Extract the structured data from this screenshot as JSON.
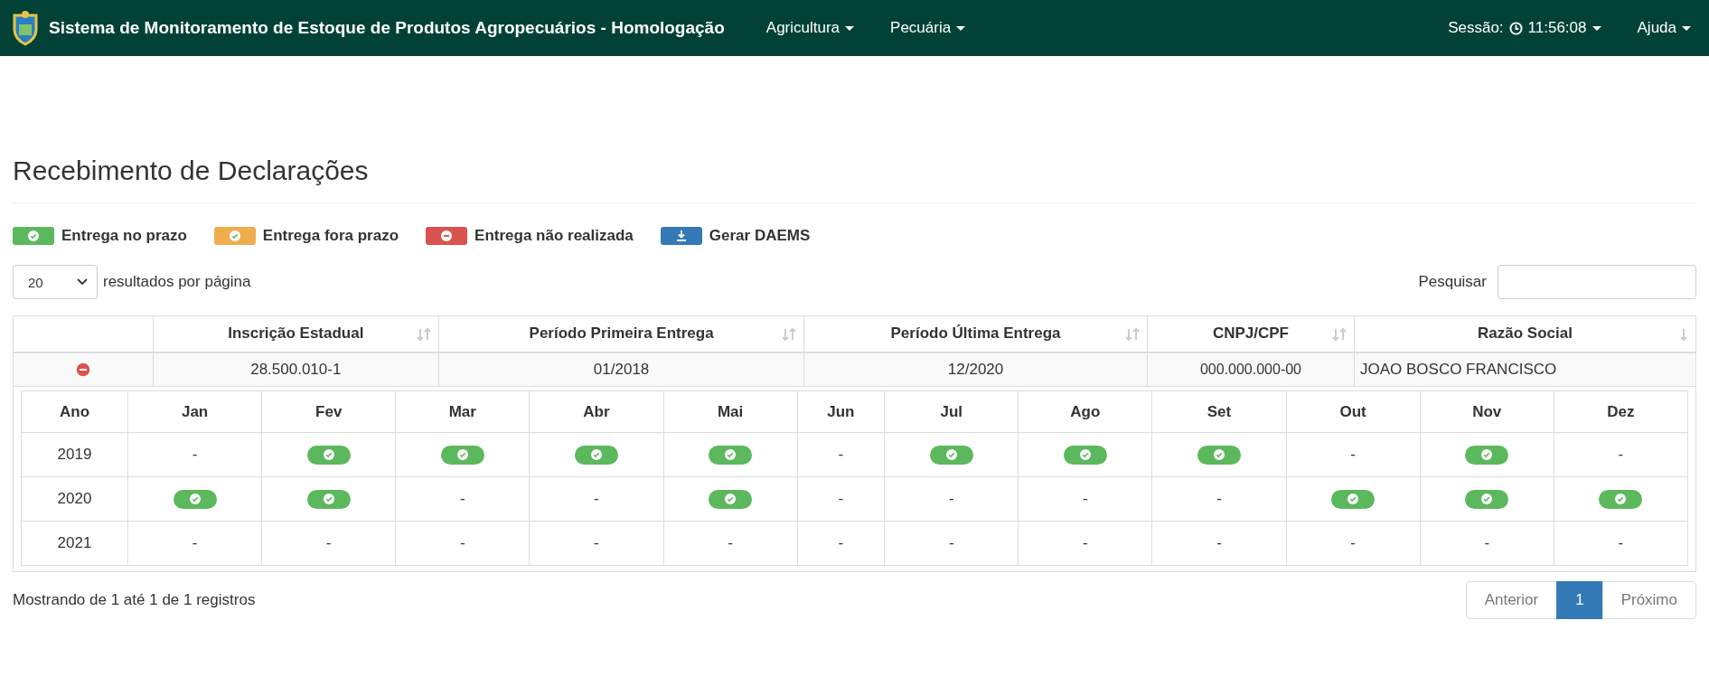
{
  "navbar": {
    "brand": "Sistema de Monitoramento de Estoque de Produtos Agropecuários - Homologação",
    "menus": [
      {
        "label": "Agricultura"
      },
      {
        "label": "Pecuária"
      }
    ],
    "session": {
      "label": "Sessão:",
      "time": "11:56:08"
    },
    "help": {
      "label": "Ajuda"
    }
  },
  "page_title": "Recebimento de Declarações",
  "legend": [
    {
      "kind": "on_time",
      "label": "Entrega no prazo"
    },
    {
      "kind": "late",
      "label": "Entrega fora prazo"
    },
    {
      "kind": "missing",
      "label": "Entrega não realizada"
    },
    {
      "kind": "download",
      "label": "Gerar DAEMS"
    }
  ],
  "page_size": {
    "value": "20",
    "label": "resultados por página"
  },
  "search": {
    "label": "Pesquisar"
  },
  "table": {
    "columns": [
      {
        "label": "Inscrição Estadual",
        "sorted": false
      },
      {
        "label": "Período Primeira Entrega",
        "sorted": false
      },
      {
        "label": "Período Última Entrega",
        "sorted": false
      },
      {
        "label": "CNPJ/CPF",
        "sorted": false
      },
      {
        "label": "Razão Social",
        "sorted": true
      }
    ],
    "rows": [
      {
        "expanded": true,
        "cells": [
          "28.500.010-1",
          "01/2018",
          "12/2020",
          "000.000.000-00",
          "JOAO BOSCO FRANCISCO"
        ],
        "detail": {
          "columns": [
            "Ano",
            "Jan",
            "Fev",
            "Mar",
            "Abr",
            "Mai",
            "Jun",
            "Jul",
            "Ago",
            "Set",
            "Out",
            "Nov",
            "Dez"
          ],
          "rows": [
            {
              "year": "2019",
              "months": [
                {
                  "kind": "text",
                  "text": "-"
                },
                {
                  "kind": "on_time"
                },
                {
                  "kind": "on_time"
                },
                {
                  "kind": "on_time"
                },
                {
                  "kind": "on_time"
                },
                {
                  "kind": "text",
                  "text": "-"
                },
                {
                  "kind": "on_time"
                },
                {
                  "kind": "on_time"
                },
                {
                  "kind": "on_time"
                },
                {
                  "kind": "text",
                  "text": "-"
                },
                {
                  "kind": "on_time"
                },
                {
                  "kind": "text",
                  "text": "-"
                }
              ]
            },
            {
              "year": "2020",
              "months": [
                {
                  "kind": "on_time"
                },
                {
                  "kind": "on_time"
                },
                {
                  "kind": "text",
                  "text": "-"
                },
                {
                  "kind": "text",
                  "text": "-"
                },
                {
                  "kind": "on_time"
                },
                {
                  "kind": "text",
                  "text": "-"
                },
                {
                  "kind": "text",
                  "text": "-"
                },
                {
                  "kind": "text",
                  "text": "-"
                },
                {
                  "kind": "text",
                  "text": "-"
                },
                {
                  "kind": "on_time"
                },
                {
                  "kind": "on_time"
                },
                {
                  "kind": "on_time"
                }
              ]
            },
            {
              "year": "2021",
              "months": [
                {
                  "kind": "text",
                  "text": "-"
                },
                {
                  "kind": "text",
                  "text": "-"
                },
                {
                  "kind": "text",
                  "text": "-"
                },
                {
                  "kind": "text",
                  "text": "-"
                },
                {
                  "kind": "text",
                  "text": "-"
                },
                {
                  "kind": "text",
                  "text": "-"
                },
                {
                  "kind": "text",
                  "text": "-"
                },
                {
                  "kind": "text",
                  "text": "-"
                },
                {
                  "kind": "text",
                  "text": "-"
                },
                {
                  "kind": "text",
                  "text": "-"
                },
                {
                  "kind": "text",
                  "text": "-"
                },
                {
                  "kind": "text",
                  "text": "-"
                }
              ]
            }
          ]
        }
      }
    ]
  },
  "info": "Mostrando de 1 até 1 de 1 registros",
  "pagination": [
    {
      "label": "Anterior",
      "selected": false,
      "disabled": true
    },
    {
      "label": "1",
      "selected": true,
      "disabled": false
    },
    {
      "label": "Próximo",
      "selected": false,
      "disabled": true
    }
  ]
}
